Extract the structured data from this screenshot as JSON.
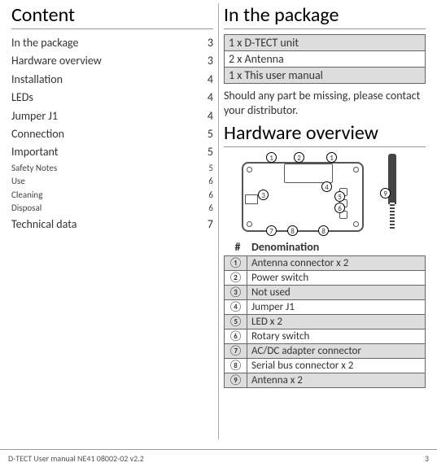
{
  "left": {
    "title": "Content",
    "toc": [
      {
        "label": "In the package",
        "page": "3"
      },
      {
        "label": "Hardware overview",
        "page": "3"
      },
      {
        "label": "Installation",
        "page": "4"
      },
      {
        "label": "LEDs",
        "page": "4"
      },
      {
        "label": "Jumper J1",
        "page": "4"
      },
      {
        "label": "Connection",
        "page": "5"
      },
      {
        "label": "Important",
        "page": "5"
      }
    ],
    "toc_sub": [
      {
        "label": "Safety Notes",
        "page": "5"
      },
      {
        "label": "Use",
        "page": "6"
      },
      {
        "label": "Cleaning",
        "page": "6"
      },
      {
        "label": "Disposal",
        "page": "6"
      }
    ],
    "toc_last": {
      "label": "Technical data",
      "page": "7"
    }
  },
  "right": {
    "pkg_title": "In the package",
    "pkg_items": [
      "1 x D-TECT unit",
      "2 x Antenna",
      "1 x This user manual"
    ],
    "pkg_note": "Should any part be missing, please contact your distributor.",
    "hw_title": "Hardware overview",
    "denom_head_num": "#",
    "denom_head_label": "Denomination",
    "denom": [
      {
        "n": "①",
        "t": "Antenna connector x 2"
      },
      {
        "n": "②",
        "t": "Power switch"
      },
      {
        "n": "③",
        "t": "Not used"
      },
      {
        "n": "④",
        "t": "Jumper J1"
      },
      {
        "n": "⑤",
        "t": "LED x 2"
      },
      {
        "n": "⑥",
        "t": "Rotary switch"
      },
      {
        "n": "⑦",
        "t": "AC/DC adapter connector"
      },
      {
        "n": "⑧",
        "t": "Serial bus connector x 2"
      },
      {
        "n": "⑨",
        "t": "Antenna x 2"
      }
    ],
    "callouts": [
      "1",
      "2",
      "1",
      "3",
      "4",
      "5",
      "6",
      "7",
      "8",
      "8",
      "9"
    ]
  },
  "footer": {
    "left": "D-TECT User manual NE41 08002-02 v2.2",
    "right": "3"
  }
}
